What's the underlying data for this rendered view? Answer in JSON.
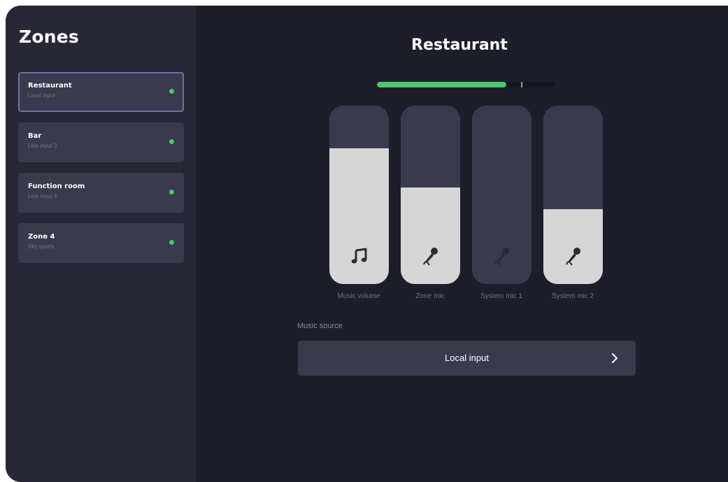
{
  "sidebar": {
    "title": "Zones",
    "zones": [
      {
        "name": "Restaurant",
        "source": "Local input",
        "selected": true,
        "status_color": "#4cc56a"
      },
      {
        "name": "Bar",
        "source": "Line input 3",
        "selected": false,
        "status_color": "#4cc56a"
      },
      {
        "name": "Function room",
        "source": "Line input 4",
        "selected": false,
        "status_color": "#4cc56a"
      },
      {
        "name": "Zone 4",
        "source": "Sky sports",
        "selected": false,
        "status_color": "#4cc56a"
      }
    ]
  },
  "main": {
    "title": "Restaurant",
    "level_meter": {
      "level": 0.73,
      "peak": 0.81,
      "color": "#4cc56a"
    },
    "faders": [
      {
        "label": "Music volume",
        "level": 0.76,
        "icon": "music-note-icon"
      },
      {
        "label": "Zone mic",
        "level": 0.54,
        "icon": "microphone-icon"
      },
      {
        "label": "System mic 1",
        "level": 0.0,
        "icon": "microphone-icon"
      },
      {
        "label": "System mic 2",
        "level": 0.42,
        "icon": "microphone-icon"
      }
    ],
    "music_source": {
      "label": "Music source",
      "value": "Local input",
      "icon": "chevron-right-icon"
    }
  },
  "colors": {
    "background": "#1d1e2a",
    "sidebar": "#272735",
    "card": "#3a3a4e",
    "accent": "#4cc56a",
    "fader_fill": "#d6d6d6"
  }
}
